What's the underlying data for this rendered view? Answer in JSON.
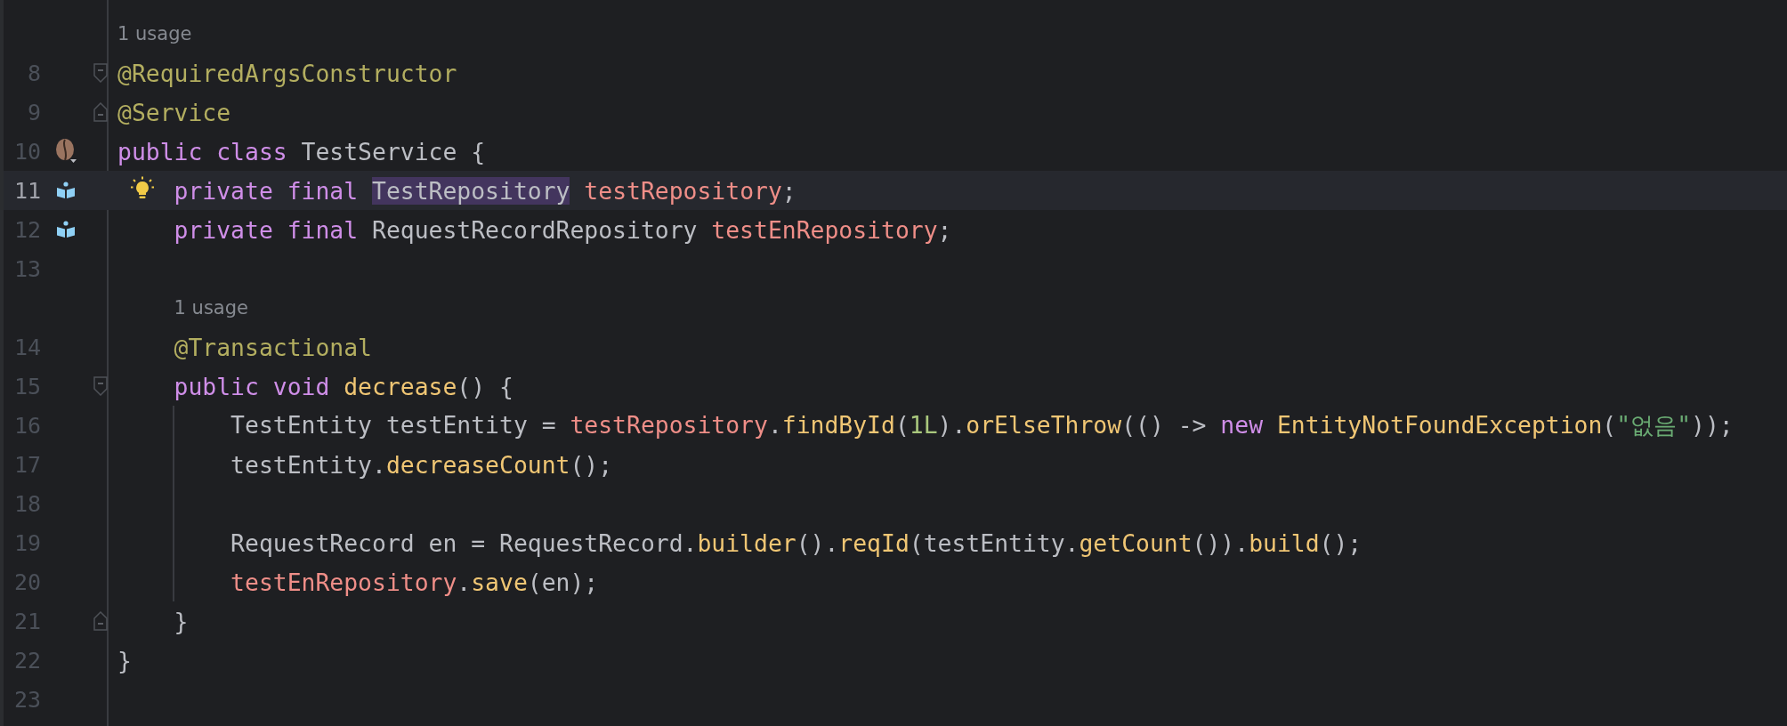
{
  "editor": {
    "rows": [
      {
        "kind": "hint",
        "indent": "",
        "text": "1 usage"
      },
      {
        "kind": "code",
        "number": "8",
        "fold_start": true,
        "indent": "",
        "tokens": [
          {
            "text": "@RequiredArgsConstructor",
            "kind": "annotation"
          }
        ]
      },
      {
        "kind": "code",
        "number": "9",
        "fold_end": true,
        "indent": "",
        "tokens": [
          {
            "text": "@Service",
            "kind": "annotation"
          }
        ]
      },
      {
        "kind": "code",
        "number": "10",
        "gutter_mark": {
          "kind": "bean"
        },
        "indent": "",
        "tokens": [
          {
            "text": "public class ",
            "kind": "keyword"
          },
          {
            "text": "TestService {",
            "kind": "plain"
          }
        ]
      },
      {
        "kind": "code",
        "number": "11",
        "gutter_mark": {
          "kind": "book"
        },
        "current": true,
        "bulb": true,
        "indent": "    ",
        "tokens": [
          {
            "text": "private final ",
            "kind": "keyword"
          },
          {
            "text": "TestRepository",
            "kind": "plain",
            "selected": true
          },
          {
            "text": " testRepository",
            "kind": "field"
          },
          {
            "text": ";",
            "kind": "plain"
          }
        ]
      },
      {
        "kind": "code",
        "number": "12",
        "gutter_mark": {
          "kind": "book"
        },
        "indent": "    ",
        "tokens": [
          {
            "text": "private final ",
            "kind": "keyword"
          },
          {
            "text": "RequestRecordRepository ",
            "kind": "plain"
          },
          {
            "text": "testEnRepository",
            "kind": "field"
          },
          {
            "text": ";",
            "kind": "plain"
          }
        ]
      },
      {
        "kind": "code",
        "number": "13",
        "indent": "",
        "tokens": []
      },
      {
        "kind": "hint",
        "indent": "    ",
        "text": "1 usage"
      },
      {
        "kind": "code",
        "number": "14",
        "indent": "    ",
        "tokens": [
          {
            "text": "@Transactional",
            "kind": "annotation"
          }
        ]
      },
      {
        "kind": "code",
        "number": "15",
        "fold_start": true,
        "indent": "    ",
        "tokens": [
          {
            "text": "public void ",
            "kind": "keyword"
          },
          {
            "text": "decrease",
            "kind": "method"
          },
          {
            "text": "() {",
            "kind": "plain"
          }
        ]
      },
      {
        "kind": "code",
        "number": "16",
        "guide": true,
        "indent": "        ",
        "tokens": [
          {
            "text": "TestEntity testEntity = ",
            "kind": "plain"
          },
          {
            "text": "testRepository",
            "kind": "field"
          },
          {
            "text": ".",
            "kind": "plain"
          },
          {
            "text": "findById",
            "kind": "method"
          },
          {
            "text": "(",
            "kind": "plain"
          },
          {
            "text": "1L",
            "kind": "number"
          },
          {
            "text": ").",
            "kind": "plain"
          },
          {
            "text": "orElseThrow",
            "kind": "method"
          },
          {
            "text": "(() -> ",
            "kind": "plain"
          },
          {
            "text": "new ",
            "kind": "keyword"
          },
          {
            "text": "EntityNotFoundException",
            "kind": "method"
          },
          {
            "text": "(",
            "kind": "plain"
          },
          {
            "text": "\"없음\"",
            "kind": "string"
          },
          {
            "text": "));",
            "kind": "plain"
          }
        ]
      },
      {
        "kind": "code",
        "number": "17",
        "guide": true,
        "indent": "        ",
        "tokens": [
          {
            "text": "testEntity.",
            "kind": "plain"
          },
          {
            "text": "decreaseCount",
            "kind": "method"
          },
          {
            "text": "();",
            "kind": "plain"
          }
        ]
      },
      {
        "kind": "code",
        "number": "18",
        "guide": true,
        "indent": "",
        "tokens": []
      },
      {
        "kind": "code",
        "number": "19",
        "guide": true,
        "indent": "        ",
        "tokens": [
          {
            "text": "RequestRecord en = RequestRecord.",
            "kind": "plain"
          },
          {
            "text": "builder",
            "kind": "method"
          },
          {
            "text": "().",
            "kind": "plain"
          },
          {
            "text": "reqId",
            "kind": "method"
          },
          {
            "text": "(testEntity.",
            "kind": "plain"
          },
          {
            "text": "getCount",
            "kind": "method"
          },
          {
            "text": "()).",
            "kind": "plain"
          },
          {
            "text": "build",
            "kind": "method"
          },
          {
            "text": "();",
            "kind": "plain"
          }
        ]
      },
      {
        "kind": "code",
        "number": "20",
        "guide": true,
        "indent": "        ",
        "tokens": [
          {
            "text": "testEnRepository",
            "kind": "field"
          },
          {
            "text": ".",
            "kind": "plain"
          },
          {
            "text": "save",
            "kind": "method"
          },
          {
            "text": "(en);",
            "kind": "plain"
          }
        ]
      },
      {
        "kind": "code",
        "number": "21",
        "fold_end": true,
        "indent": "    ",
        "tokens": [
          {
            "text": "}",
            "kind": "plain"
          }
        ]
      },
      {
        "kind": "code",
        "number": "22",
        "indent": "",
        "tokens": [
          {
            "text": "}",
            "kind": "plain"
          }
        ]
      },
      {
        "kind": "code",
        "number": "23",
        "indent": "",
        "tokens": []
      }
    ]
  }
}
